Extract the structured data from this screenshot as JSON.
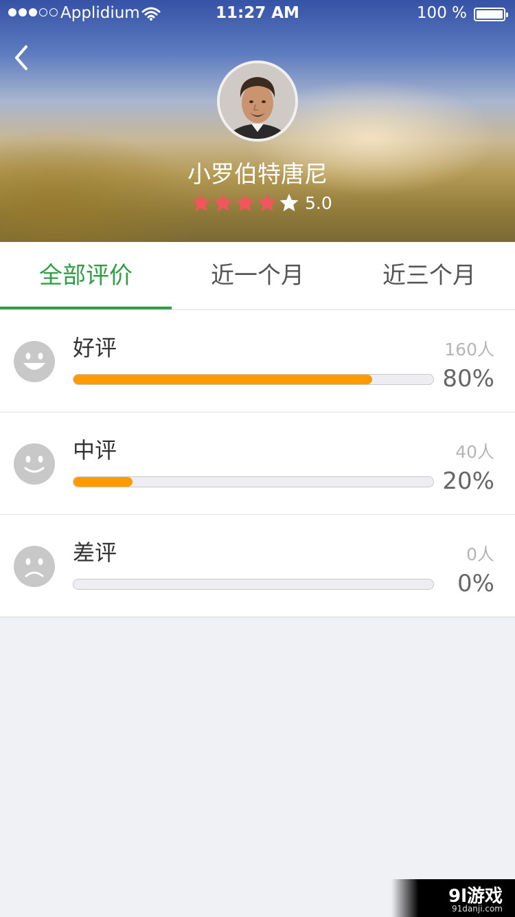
{
  "status_bar": {
    "carrier": "Applidium",
    "time": "11:27 AM",
    "battery": "100 %"
  },
  "profile": {
    "name": "小罗伯特唐尼",
    "stars_filled": 4,
    "stars_total": 5,
    "score": "5.0"
  },
  "colors": {
    "accent_green": "#2f9e44",
    "bar_orange": "#ff9a00",
    "star_red": "#f2555b"
  },
  "tabs": [
    {
      "label": "全部评价",
      "active": true
    },
    {
      "label": "近一个月",
      "active": false
    },
    {
      "label": "近三个月",
      "active": false
    }
  ],
  "ratings": [
    {
      "icon": "smile-icon",
      "label": "好评",
      "count": "160人",
      "percent": "80%",
      "fill": 0.83
    },
    {
      "icon": "neutral-face-icon",
      "label": "中评",
      "count": "40人",
      "percent": "20%",
      "fill": 0.165
    },
    {
      "icon": "sad-face-icon",
      "label": "差评",
      "count": "0人",
      "percent": "0%",
      "fill": 0
    }
  ],
  "watermark": {
    "title": "9l游戏",
    "sub": "91danji.com"
  }
}
